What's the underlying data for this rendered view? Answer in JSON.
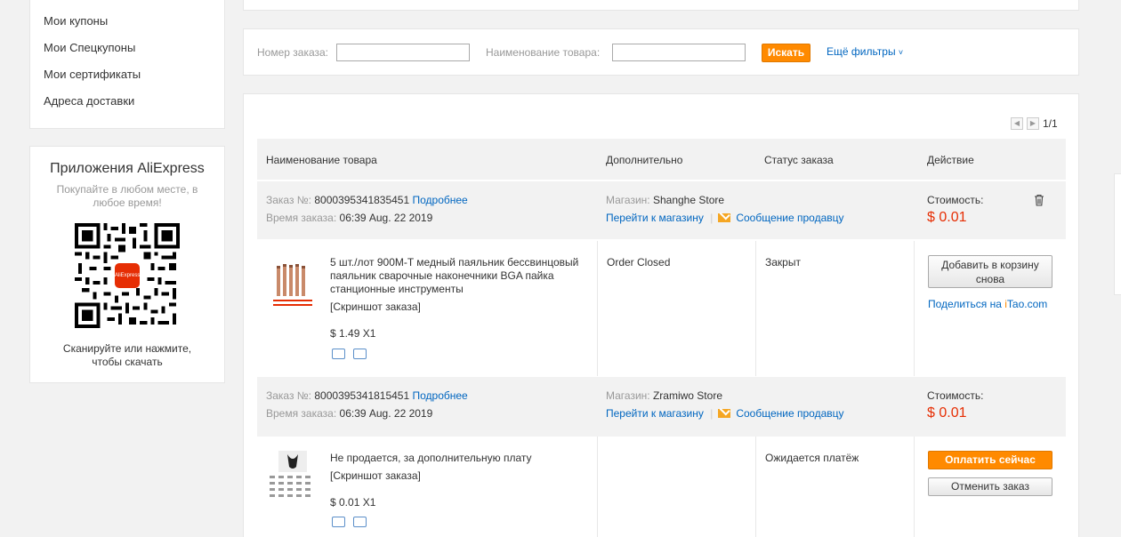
{
  "sidebar": {
    "menu": [
      "Мои купоны",
      "Мои Спецкупоны",
      "Мои сертификаты",
      "Адреса доставки"
    ],
    "app": {
      "title": "Приложения AliExpress",
      "subtitle": "Покупайте в любом месте, в любое время!",
      "qr_logo": "AliExpress",
      "scan_text": "Сканируйте или нажмите, чтобы скачать"
    }
  },
  "filter": {
    "order_number_label": "Номер заказа:",
    "order_number_value": "",
    "product_name_label": "Наименование товара:",
    "product_name_value": "",
    "search_button": "Искать",
    "more_filters": "Ещё фильтры"
  },
  "pagination": {
    "text": "1/1"
  },
  "table_headers": {
    "product": "Наименование товара",
    "extra": "Дополнительно",
    "status": "Статус заказа",
    "action": "Действие"
  },
  "order_labels": {
    "order_no": "Заказ №:",
    "details": "Подробнее",
    "order_time": "Время заказа:",
    "store": "Магазин:",
    "go_to_store": "Перейти к магазину",
    "separator": "|",
    "message_seller": "Сообщение продавцу",
    "cost": "Стоимость:",
    "screenshot": "[Скриншот заказа]"
  },
  "orders": [
    {
      "number": "8000395341835451",
      "time": "06:39 Aug. 22 2019",
      "store": "Shanghe Store",
      "cost": "$ 0.01",
      "product_name": "5 шт./лот 900M-T медный паяльник бессвинцовый паяльник сварочные наконечники BGA пайка станционные инструменты",
      "unit_price": "$ 1.49 X1",
      "extra": "Order Closed",
      "status": "Закрыт",
      "action_primary": "Добавить в корзину снова",
      "share_text": "Поделиться на ",
      "share_brand_i": "i",
      "share_brand_rest": "Tao.com"
    },
    {
      "number": "8000395341815451",
      "time": "06:39 Aug. 22 2019",
      "store": "Zramiwo Store",
      "cost": "$ 0.01",
      "product_name": "Не продается, за дополнительную плату",
      "unit_price": "$ 0.01 X1",
      "extra": "",
      "status": "Ожидается платёж",
      "action_pay": "Оплатить сейчас",
      "action_cancel": "Отменить заказ"
    }
  ],
  "colors": {
    "accent_orange": "#ff8a00",
    "price_red": "#e62e04",
    "link_blue": "#0066c0"
  }
}
